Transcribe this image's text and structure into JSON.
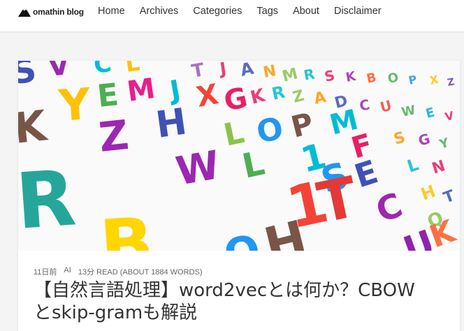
{
  "header": {
    "logo_text": "omathin blog",
    "logo_icon": "mountain-logo-icon",
    "nav": [
      "Home",
      "Archives",
      "Categories",
      "Tags",
      "About",
      "Disclaimer"
    ]
  },
  "post": {
    "hero_image": "colorful-hand-drawn-alphabet-letters",
    "meta": {
      "date": "11日前",
      "category": "AI",
      "read": "13分 READ (ABOUT 1884 WORDS)"
    },
    "title_line1": "【自然言語処理】word2vecとは何か？CBOW",
    "title_line2": "とskip-gramも解説"
  }
}
